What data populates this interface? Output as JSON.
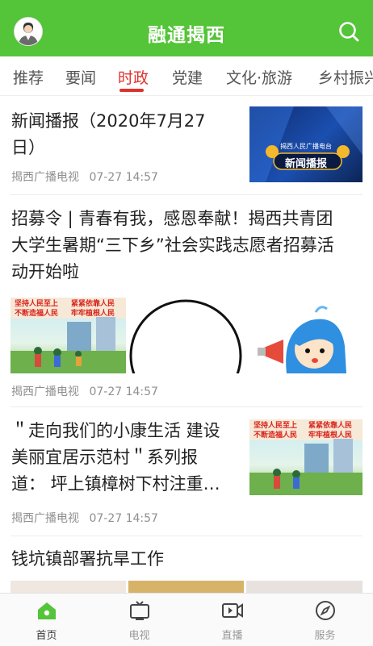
{
  "header": {
    "title": "融通揭西",
    "avatar_icon": "user-avatar",
    "search_icon": "search-icon"
  },
  "tabs": [
    {
      "label": "推荐"
    },
    {
      "label": "要闻"
    },
    {
      "label": "时政",
      "active": true
    },
    {
      "label": "党建"
    },
    {
      "label": "文化·旅游"
    },
    {
      "label": "乡村振兴"
    }
  ],
  "feed": [
    {
      "title_line1": "新闻播报（2020年7月27",
      "title_line2": "日）",
      "source": "揭西广播电视",
      "time": "07-27 14:57",
      "thumb": {
        "station_text": "揭西人民广播电台",
        "show_text": "新闻播报"
      }
    },
    {
      "title_line1": "招募令 | 青春有我，感恩奉献！揭西共青团",
      "title_line2": "大学生暑期“三下乡”社会实践志愿者招募活",
      "title_line3": "动开始啦",
      "source": "揭西广播电视",
      "time": "07-27 14:57",
      "thumb": {
        "slogan_left": "坚持人民至上",
        "slogan_left2": "不断造福人民",
        "slogan_right": "紧紧依靠人民",
        "slogan_right2": "牢牢植根人民"
      }
    },
    {
      "title_line1": "＂走向我们的小康生活 建设",
      "title_line2": "美丽宜居示范村＂系列报",
      "title_line3": "道： 坪上镇樟树下村注重…",
      "source": "揭西广播电视",
      "time": "07-27 14:57",
      "thumb": {
        "slogan_left": "坚持人民至上",
        "slogan_left2": "不断造福人民",
        "slogan_right": "紧紧依靠人民",
        "slogan_right2": "牢牢植根人民"
      }
    },
    {
      "title_line1": "钱坑镇部署抗旱工作"
    }
  ],
  "bottom_nav": [
    {
      "label": "首页",
      "icon": "home-icon",
      "active": true
    },
    {
      "label": "电视",
      "icon": "tv-icon"
    },
    {
      "label": "直播",
      "icon": "live-icon"
    },
    {
      "label": "服务",
      "icon": "compass-icon"
    }
  ],
  "colors": {
    "brand_green": "#54c438",
    "active_tab_red": "#e0312c",
    "meta_gray": "#8f8f8f"
  }
}
